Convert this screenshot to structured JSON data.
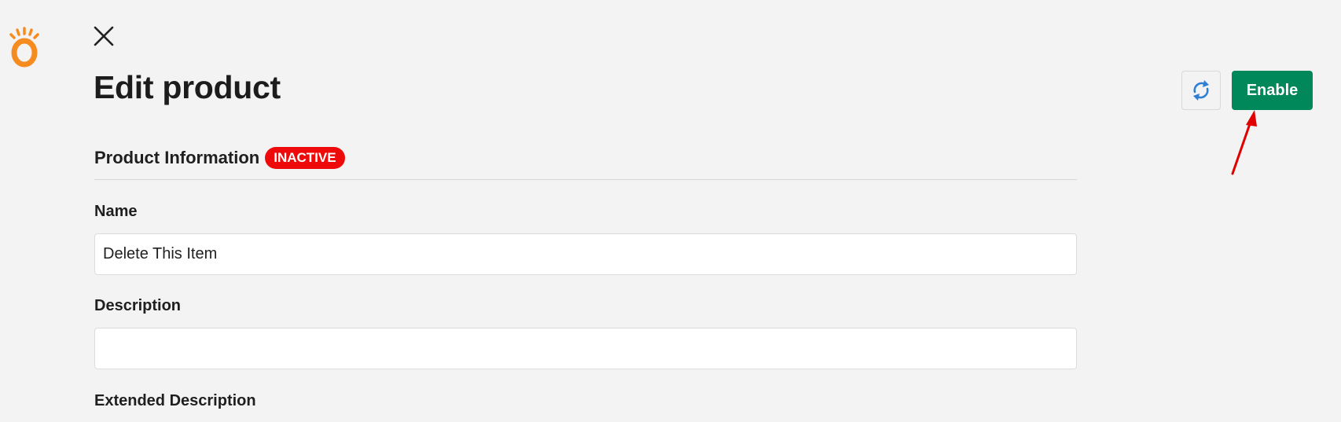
{
  "header": {
    "title": "Edit product",
    "close_icon": "close-icon",
    "logo_icon": "brand-logo-icon",
    "refresh_icon": "refresh-sync-icon",
    "enable_label": "Enable"
  },
  "section": {
    "title": "Product Information",
    "status_badge": "INACTIVE"
  },
  "form": {
    "name_label": "Name",
    "name_value": "Delete This Item",
    "description_label": "Description",
    "description_value": "",
    "extended_description_label": "Extended Description"
  },
  "colors": {
    "brand_orange": "#f68b1f",
    "enable_green": "#00875a",
    "badge_red": "#ee0a0a",
    "refresh_blue": "#2f7fd6",
    "annotation_arrow": "#e00000"
  }
}
